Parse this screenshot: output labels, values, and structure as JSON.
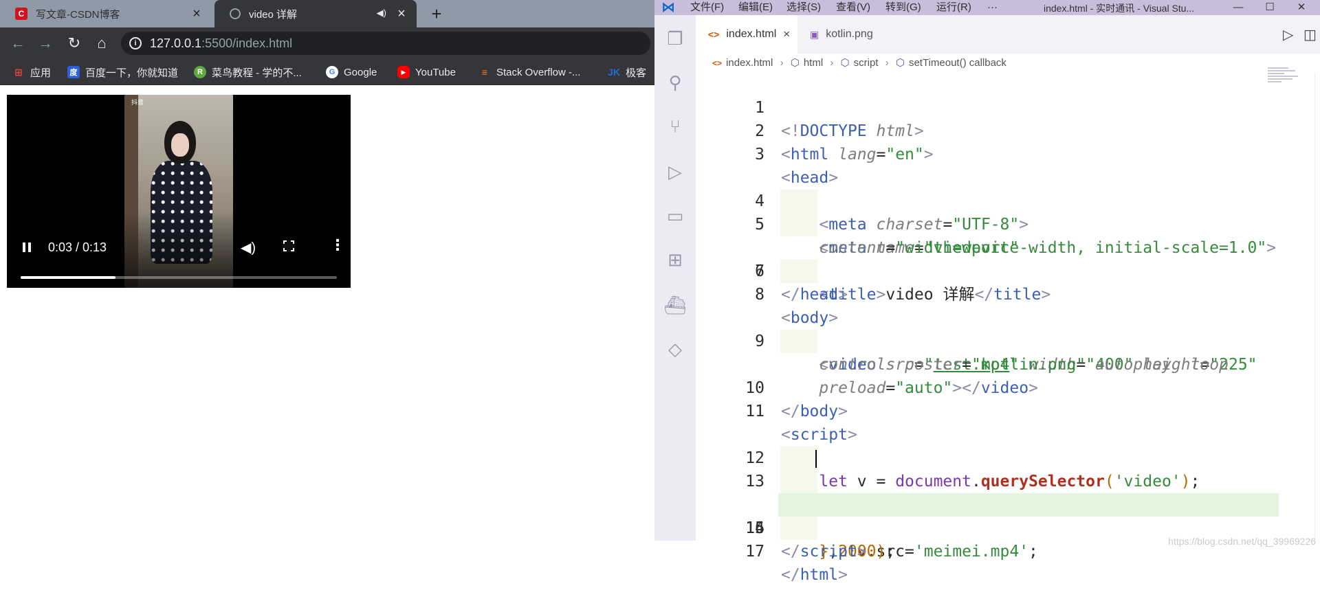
{
  "browser": {
    "tabs": [
      {
        "title": "写文章-CSDN博客",
        "active": false,
        "favicon": "csdn-icon"
      },
      {
        "title": "video 详解",
        "active": true,
        "favicon": "globe-icon",
        "audio": true
      }
    ],
    "new_tab_label": "+",
    "nav": {
      "back": "←",
      "forward": "→",
      "reload": "↻",
      "home": "⌂"
    },
    "address": {
      "host": "127.0.0.1",
      "rest": ":5500/index.html",
      "info_icon": "i"
    },
    "bookmarks": [
      {
        "label": "应用",
        "icon": "apps-grid-icon",
        "color": "#e8453c"
      },
      {
        "label": "百度一下，你就知道",
        "icon": "baidu-icon",
        "color": "#3060d8"
      },
      {
        "label": "菜鸟教程 - 学的不...",
        "icon": "runoob-icon",
        "color": "#5eaa3c"
      },
      {
        "label": "Google",
        "icon": "google-icon",
        "color": "#4285f4"
      },
      {
        "label": "YouTube",
        "icon": "youtube-icon",
        "color": "#ff0000"
      },
      {
        "label": "Stack Overflow -...",
        "icon": "stackoverflow-icon",
        "color": "#f48024"
      },
      {
        "label": "极客",
        "icon": "jike-icon",
        "color": "#1f6fd0"
      }
    ]
  },
  "video": {
    "time": "0:03 / 0:13",
    "progress": 0.3,
    "watermark": "抖音"
  },
  "vscode": {
    "menu": [
      "文件(F)",
      "编辑(E)",
      "选择(S)",
      "查看(V)",
      "转到(G)",
      "运行(R)",
      "···"
    ],
    "window_title": "index.html - 实时通讯 - Visual Stu...",
    "win_buttons": {
      "minimize": "—",
      "maximize": "☐",
      "close": "✕"
    },
    "tabs": [
      {
        "label": "index.html",
        "icon": "<>",
        "active": true,
        "close": "×"
      },
      {
        "label": "kotlin.png",
        "icon": "▣",
        "active": false
      }
    ],
    "breadcrumb": {
      "file": "index.html",
      "items": [
        "html",
        "script",
        "setTimeout() callback"
      ],
      "sep": "›"
    },
    "line_numbers": [
      "1",
      "2",
      "3",
      "4",
      "5",
      "",
      "6",
      "7",
      "8",
      "9",
      "",
      "",
      "10",
      "11",
      "12",
      "13",
      "14",
      "15",
      "16",
      "17"
    ],
    "watermark": "https://blog.csdn.net/qq_39969226"
  }
}
